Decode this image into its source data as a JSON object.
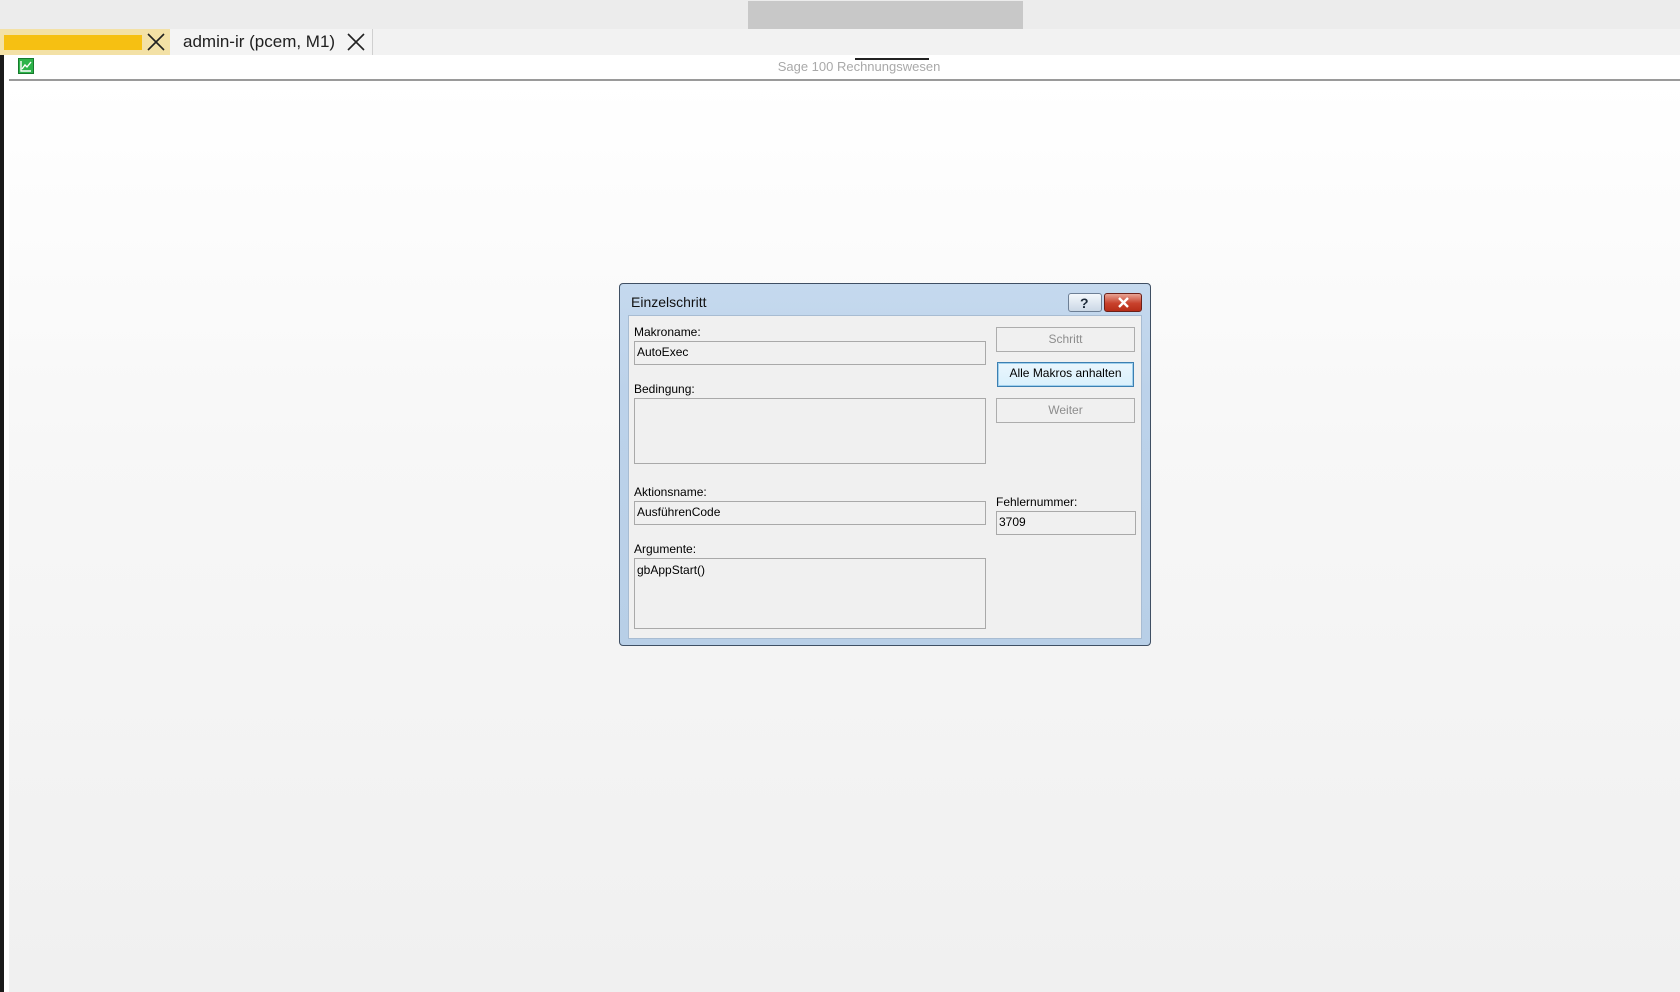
{
  "tabs": [
    {
      "label": "",
      "color": "#f6c012"
    },
    {
      "label": "admin-ir (pcem, M1)"
    }
  ],
  "app": {
    "title": "Sage 100 Rechnungswesen",
    "icon": "chart-icon"
  },
  "dialog": {
    "title": "Einzelschritt",
    "fields": {
      "macro_name_label": "Makroname:",
      "macro_name_value": "AutoExec",
      "condition_label": "Bedingung:",
      "condition_value": "",
      "action_name_label": "Aktionsname:",
      "action_name_value": "AusführenCode",
      "arguments_label": "Argumente:",
      "arguments_value": "gbAppStart()",
      "error_number_label": "Fehlernummer:",
      "error_number_value": "3709"
    },
    "buttons": {
      "step": "Schritt",
      "stop_all": "Alle Makros anhalten",
      "continue": "Weiter"
    }
  }
}
